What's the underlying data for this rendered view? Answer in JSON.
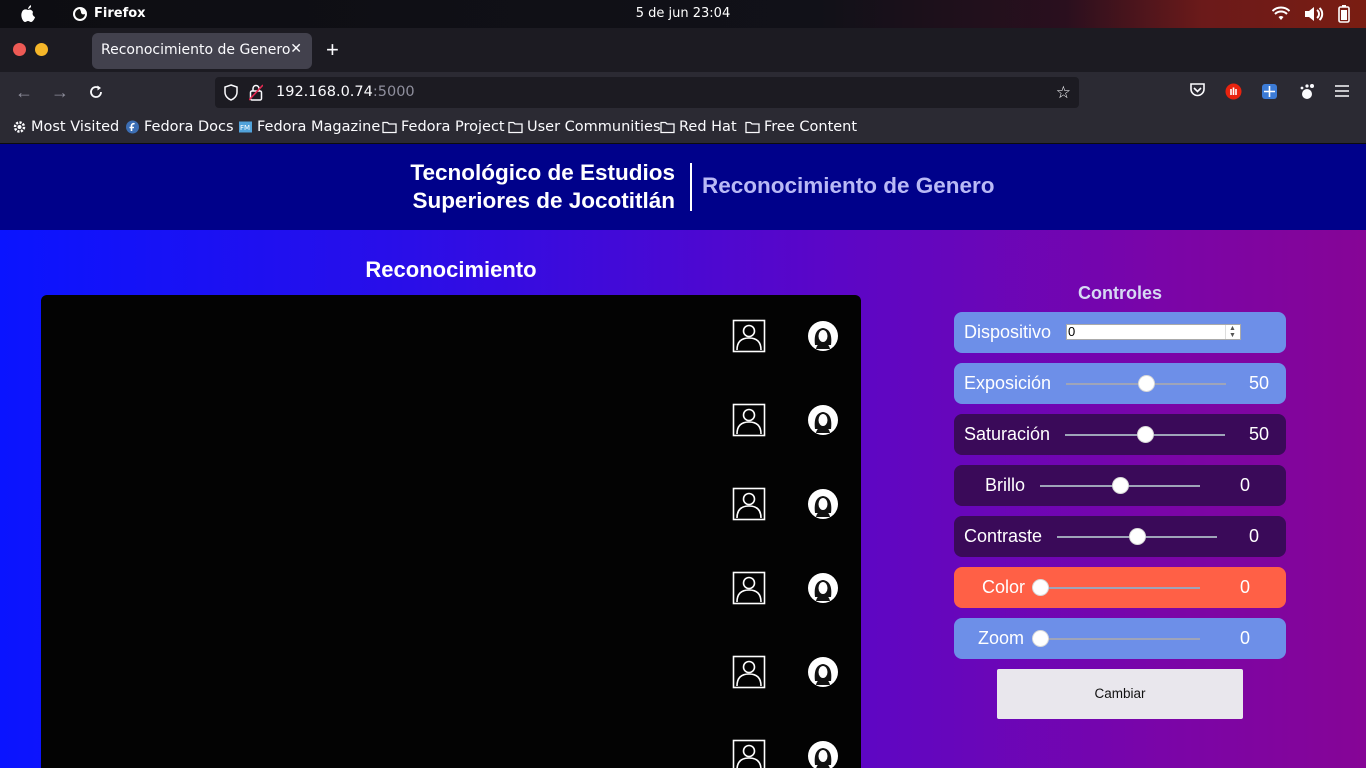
{
  "os": {
    "app_name": "Firefox",
    "clock": "5 de jun  23:04"
  },
  "browser": {
    "tab_title": "Reconocimiento de Genero",
    "url_host": "192.168.0.74",
    "url_port": ":5000",
    "bookmarks": [
      "Most Visited",
      "Fedora Docs",
      "Fedora Magazine",
      "Fedora Project",
      "User Communities",
      "Red Hat",
      "Free Content"
    ]
  },
  "header": {
    "institution_line1": "Tecnológico de Estudios",
    "institution_line2": "Superiores de Jocotitlán",
    "app_title": "Reconocimiento de Genero"
  },
  "main": {
    "section_title": "Reconocimiento",
    "video_feed": "black"
  },
  "controls": {
    "title": "Controles",
    "dispositivo": {
      "label": "Dispositivo",
      "value": "0"
    },
    "exposicion": {
      "label": "Exposición",
      "value": "50",
      "fraction": 0.5
    },
    "saturacion": {
      "label": "Saturación",
      "value": "50",
      "fraction": 0.5
    },
    "brillo": {
      "label": "Brillo",
      "value": "0",
      "fraction": 0.5
    },
    "contraste": {
      "label": "Contraste",
      "value": "0",
      "fraction": 0.5
    },
    "color": {
      "label": "Color",
      "value": "0",
      "fraction": 0.0
    },
    "zoom": {
      "label": "Zoom",
      "value": "0",
      "fraction": 0.0
    },
    "button_label": "Cambiar"
  },
  "colors": {
    "header_bg": "#00018a",
    "control_blue": "#6d8fe8",
    "control_dark": "#3a0a59",
    "control_orange": "#ff6046",
    "gradient_start": "#0a14ff",
    "gradient_end": "#860596"
  }
}
